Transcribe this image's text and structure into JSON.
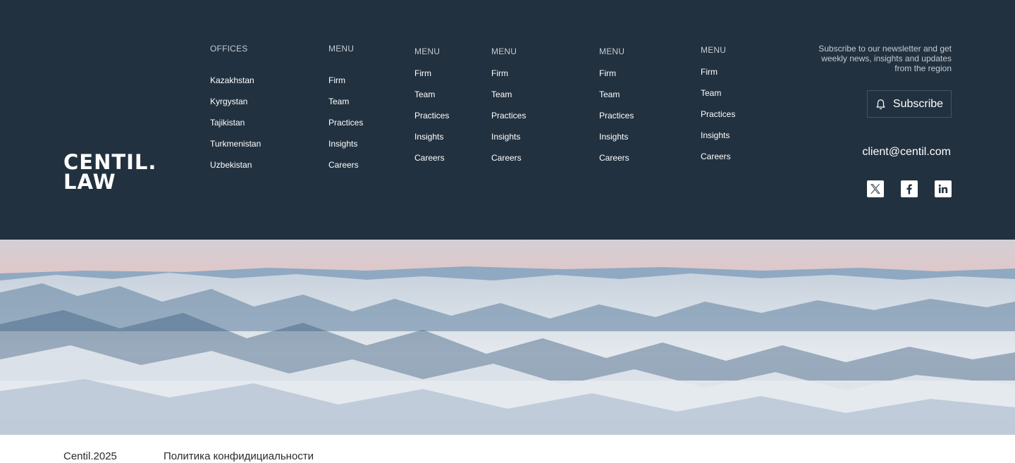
{
  "brand": {
    "logo_line1": "CENTIL.",
    "logo_line2": "LAW"
  },
  "columns": [
    {
      "heading": "OFFICES",
      "items": [
        "Kazakhstan",
        "Kyrgystan",
        "Tajikistan",
        "Turkmenistan",
        "Uzbekistan"
      ]
    },
    {
      "heading": "MENU",
      "items": [
        "Firm",
        "Team",
        "Practices",
        "Insights",
        "Careers"
      ]
    },
    {
      "heading": "MENU",
      "items": [
        "Firm",
        "Team",
        "Practices",
        "Insights",
        "Careers"
      ]
    },
    {
      "heading": "MENU",
      "items": [
        "Firm",
        "Team",
        "Practices",
        "Insights",
        "Careers"
      ]
    },
    {
      "heading": "MENU",
      "items": [
        "Firm",
        "Team",
        "Practices",
        "Insights",
        "Careers"
      ]
    },
    {
      "heading": "MENU",
      "items": [
        "Firm",
        "Team",
        "Practices",
        "Insights",
        "Careers"
      ]
    }
  ],
  "newsletter": {
    "line1": "Subscribe to our newsletter and get",
    "line2": "weekly news, insights and updates",
    "line3": "from the region",
    "button_label": "Subscribe",
    "button_icon": "bell-icon"
  },
  "contact": {
    "email": "client@centil.com"
  },
  "social": [
    {
      "name": "x-icon"
    },
    {
      "name": "facebook-icon"
    },
    {
      "name": "linkedin-icon"
    }
  ],
  "hero": {
    "image": "snowy-mountain-range-panorama"
  },
  "bottom": {
    "copyright": "Centil.2025",
    "privacy_link": "Политика конфидициальности"
  },
  "colors": {
    "footer_bg": "#22313f",
    "text": "#ffffff",
    "muted": "#c5cbd2"
  }
}
